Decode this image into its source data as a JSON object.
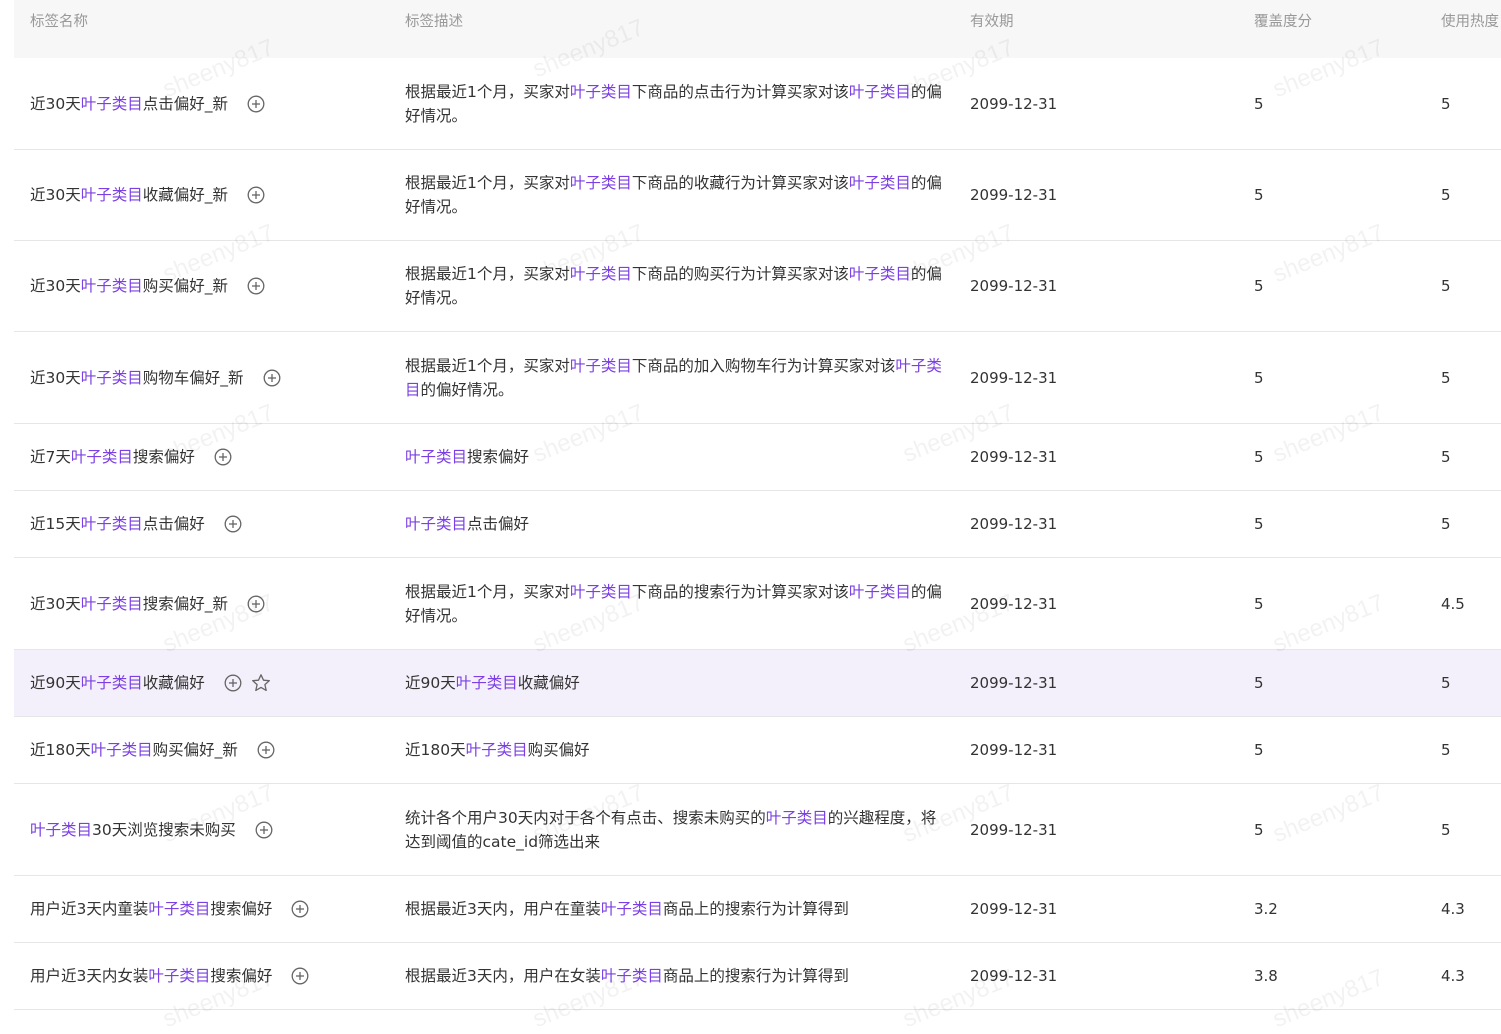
{
  "columns": {
    "name": "标签名称",
    "desc": "标签描述",
    "expiry": "有效期",
    "coverage": "覆盖度分",
    "heat": "使用热度"
  },
  "watermark_text": "sheeny817",
  "highlight_color": "#7b3fe4",
  "rows": [
    {
      "name": [
        {
          "t": "近30天"
        },
        {
          "t": "叶子类目",
          "hl": true
        },
        {
          "t": "点击偏好_新"
        }
      ],
      "desc": [
        {
          "t": "根据最近1个月，买家对"
        },
        {
          "t": "叶子类目",
          "hl": true
        },
        {
          "t": "下商品的点击行为计算买家对该"
        },
        {
          "t": "叶子类目",
          "hl": true
        },
        {
          "t": "的偏好情况。"
        }
      ],
      "expiry": "2099-12-31",
      "coverage": "5",
      "heat": "5",
      "height": 92
    },
    {
      "name": [
        {
          "t": "近30天"
        },
        {
          "t": "叶子类目",
          "hl": true
        },
        {
          "t": "收藏偏好_新"
        }
      ],
      "desc": [
        {
          "t": "根据最近1个月，买家对"
        },
        {
          "t": "叶子类目",
          "hl": true
        },
        {
          "t": "下商品的收藏行为计算买家对该"
        },
        {
          "t": "叶子类目",
          "hl": true
        },
        {
          "t": "的偏好情况。"
        }
      ],
      "expiry": "2099-12-31",
      "coverage": "5",
      "heat": "5",
      "height": 91
    },
    {
      "name": [
        {
          "t": "近30天"
        },
        {
          "t": "叶子类目",
          "hl": true
        },
        {
          "t": "购买偏好_新"
        }
      ],
      "desc": [
        {
          "t": "根据最近1个月，买家对"
        },
        {
          "t": "叶子类目",
          "hl": true
        },
        {
          "t": "下商品的购买行为计算买家对该"
        },
        {
          "t": "叶子类目",
          "hl": true
        },
        {
          "t": "的偏好情况。"
        }
      ],
      "expiry": "2099-12-31",
      "coverage": "5",
      "heat": "5",
      "height": 91
    },
    {
      "name": [
        {
          "t": "近30天"
        },
        {
          "t": "叶子类目",
          "hl": true
        },
        {
          "t": "购物车偏好_新"
        }
      ],
      "desc": [
        {
          "t": "根据最近1个月，买家对"
        },
        {
          "t": "叶子类目",
          "hl": true
        },
        {
          "t": "下商品的加入购物车行为计算买家对该"
        },
        {
          "t": "叶子类目",
          "hl": true
        },
        {
          "t": "的偏好情况。"
        }
      ],
      "expiry": "2099-12-31",
      "coverage": "5",
      "heat": "5",
      "height": 92
    },
    {
      "name": [
        {
          "t": "近7天"
        },
        {
          "t": "叶子类目",
          "hl": true
        },
        {
          "t": "搜索偏好"
        }
      ],
      "desc": [
        {
          "t": "叶子类目",
          "hl": true
        },
        {
          "t": "搜索偏好"
        }
      ],
      "expiry": "2099-12-31",
      "coverage": "5",
      "heat": "5",
      "height": 67
    },
    {
      "name": [
        {
          "t": "近15天"
        },
        {
          "t": "叶子类目",
          "hl": true
        },
        {
          "t": "点击偏好"
        }
      ],
      "desc": [
        {
          "t": "叶子类目",
          "hl": true
        },
        {
          "t": "点击偏好"
        }
      ],
      "expiry": "2099-12-31",
      "coverage": "5",
      "heat": "5",
      "height": 67
    },
    {
      "name": [
        {
          "t": "近30天"
        },
        {
          "t": "叶子类目",
          "hl": true
        },
        {
          "t": "搜索偏好_新"
        }
      ],
      "desc": [
        {
          "t": "根据最近1个月，买家对"
        },
        {
          "t": "叶子类目",
          "hl": true
        },
        {
          "t": "下商品的搜索行为计算买家对该"
        },
        {
          "t": "叶子类目",
          "hl": true
        },
        {
          "t": "的偏好情况。"
        }
      ],
      "expiry": "2099-12-31",
      "coverage": "5",
      "heat": "4.5",
      "height": 92
    },
    {
      "name": [
        {
          "t": "近90天"
        },
        {
          "t": "叶子类目",
          "hl": true
        },
        {
          "t": "收藏偏好"
        }
      ],
      "desc": [
        {
          "t": "近90天"
        },
        {
          "t": "叶子类目",
          "hl": true
        },
        {
          "t": "收藏偏好"
        }
      ],
      "expiry": "2099-12-31",
      "coverage": "5",
      "heat": "5",
      "height": 67,
      "selected": true,
      "star": true
    },
    {
      "name": [
        {
          "t": "近180天"
        },
        {
          "t": "叶子类目",
          "hl": true
        },
        {
          "t": "购买偏好_新"
        }
      ],
      "desc": [
        {
          "t": "近180天"
        },
        {
          "t": "叶子类目",
          "hl": true
        },
        {
          "t": "购买偏好"
        }
      ],
      "expiry": "2099-12-31",
      "coverage": "5",
      "heat": "5",
      "height": 67
    },
    {
      "name": [
        {
          "t": "叶子类目",
          "hl": true
        },
        {
          "t": "30天浏览搜索未购买"
        }
      ],
      "desc": [
        {
          "t": "统计各个用户30天内对于各个有点击、搜索未购买的"
        },
        {
          "t": "叶子类目",
          "hl": true
        },
        {
          "t": "的兴趣程度，将达到阈值的cate_id筛选出来"
        }
      ],
      "expiry": "2099-12-31",
      "coverage": "5",
      "heat": "5",
      "height": 92
    },
    {
      "name": [
        {
          "t": "用户近3天内童装"
        },
        {
          "t": "叶子类目",
          "hl": true
        },
        {
          "t": "搜索偏好"
        }
      ],
      "desc": [
        {
          "t": "根据最近3天内，用户在童装"
        },
        {
          "t": "叶子类目",
          "hl": true
        },
        {
          "t": "商品上的搜索行为计算得到"
        }
      ],
      "expiry": "2099-12-31",
      "coverage": "3.2",
      "heat": "4.3",
      "height": 67
    },
    {
      "name": [
        {
          "t": "用户近3天内女装"
        },
        {
          "t": "叶子类目",
          "hl": true
        },
        {
          "t": "搜索偏好"
        }
      ],
      "desc": [
        {
          "t": "根据最近3天内，用户在女装"
        },
        {
          "t": "叶子类目",
          "hl": true
        },
        {
          "t": "商品上的搜索行为计算得到"
        }
      ],
      "expiry": "2099-12-31",
      "coverage": "3.8",
      "heat": "4.3",
      "height": 67
    }
  ]
}
